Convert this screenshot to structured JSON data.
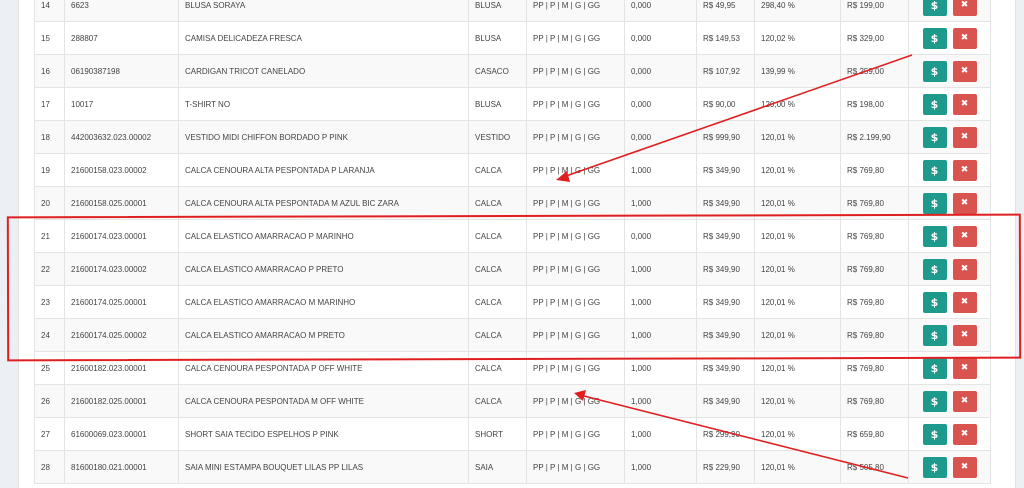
{
  "table": {
    "rows": [
      {
        "num": "14",
        "code": "6623",
        "desc": "BLUSA SORAYA",
        "cat": "BLUSA",
        "sizes": "PP | P | M | G | GG",
        "qty": "0,000",
        "cost": "R$ 49,95",
        "margin": "298,40 %",
        "price": "R$ 199,00"
      },
      {
        "num": "15",
        "code": "288807",
        "desc": "CAMISA DELICADEZA FRESCA",
        "cat": "BLUSA",
        "sizes": "PP | P | M | G | GG",
        "qty": "0,000",
        "cost": "R$ 149,53",
        "margin": "120,02 %",
        "price": "R$ 329,00"
      },
      {
        "num": "16",
        "code": "06190387198",
        "desc": "CARDIGAN TRICOT CANELADO",
        "cat": "CASACO",
        "sizes": "PP | P | M | G | GG",
        "qty": "0,000",
        "cost": "R$ 107,92",
        "margin": "139,99 %",
        "price": "R$ 259,00"
      },
      {
        "num": "17",
        "code": "10017",
        "desc": "T-SHIRT NO",
        "cat": "BLUSA",
        "sizes": "PP | P | M | G | GG",
        "qty": "0,000",
        "cost": "R$ 90,00",
        "margin": "120,00 %",
        "price": "R$ 198,00"
      },
      {
        "num": "18",
        "code": "442003632.023.00002",
        "desc": "VESTIDO MIDI CHIFFON BORDADO P PINK",
        "cat": "VESTIDO",
        "sizes": "PP | P | M | G | GG",
        "qty": "0,000",
        "cost": "R$ 999,90",
        "margin": "120,01 %",
        "price": "R$ 2.199,90"
      },
      {
        "num": "19",
        "code": "21600158.023.00002",
        "desc": "CALCA CENOURA ALTA PESPONTADA P LARANJA",
        "cat": "CALCA",
        "sizes": "PP | P | M | G | GG",
        "qty": "1,000",
        "cost": "R$ 349,90",
        "margin": "120,01 %",
        "price": "R$ 769,80"
      },
      {
        "num": "20",
        "code": "21600158.025.00001",
        "desc": "CALCA CENOURA ALTA PESPONTADA M AZUL BIC ZARA",
        "cat": "CALCA",
        "sizes": "PP | P | M | G | GG",
        "qty": "1,000",
        "cost": "R$ 349,90",
        "margin": "120,01 %",
        "price": "R$ 769,80"
      },
      {
        "num": "21",
        "code": "21600174.023.00001",
        "desc": "CALCA ELASTICO AMARRACAO P MARINHO",
        "cat": "CALCA",
        "sizes": "PP | P | M | G | GG",
        "qty": "0,000",
        "cost": "R$ 349,90",
        "margin": "120,01 %",
        "price": "R$ 769,80"
      },
      {
        "num": "22",
        "code": "21600174.023.00002",
        "desc": "CALCA ELASTICO AMARRACAO P PRETO",
        "cat": "CALCA",
        "sizes": "PP | P | M | G | GG",
        "qty": "1,000",
        "cost": "R$ 349,90",
        "margin": "120,01 %",
        "price": "R$ 769,80"
      },
      {
        "num": "23",
        "code": "21600174.025.00001",
        "desc": "CALCA ELASTICO AMARRACAO M MARINHO",
        "cat": "CALCA",
        "sizes": "PP | P | M | G | GG",
        "qty": "1,000",
        "cost": "R$ 349,90",
        "margin": "120,01 %",
        "price": "R$ 769,80"
      },
      {
        "num": "24",
        "code": "21600174.025.00002",
        "desc": "CALCA ELASTICO AMARRACAO M PRETO",
        "cat": "CALCA",
        "sizes": "PP | P | M | G | GG",
        "qty": "1,000",
        "cost": "R$ 349,90",
        "margin": "120,01 %",
        "price": "R$ 769,80"
      },
      {
        "num": "25",
        "code": "21600182.023.00001",
        "desc": "CALCA CENOURA PESPONTADA P OFF WHITE",
        "cat": "CALCA",
        "sizes": "PP | P | M | G | GG",
        "qty": "1,000",
        "cost": "R$ 349,90",
        "margin": "120,01 %",
        "price": "R$ 769,80"
      },
      {
        "num": "26",
        "code": "21600182.025.00001",
        "desc": "CALCA CENOURA PESPONTADA M OFF WHITE",
        "cat": "CALCA",
        "sizes": "PP | P | M | G | GG",
        "qty": "1,000",
        "cost": "R$ 349,90",
        "margin": "120,01 %",
        "price": "R$ 769,80"
      },
      {
        "num": "27",
        "code": "61600069.023.00001",
        "desc": "SHORT SAIA TECIDO ESPELHOS P PINK",
        "cat": "SHORT",
        "sizes": "PP | P | M | G | GG",
        "qty": "1,000",
        "cost": "R$ 299,90",
        "margin": "120,01 %",
        "price": "R$ 659,80"
      },
      {
        "num": "28",
        "code": "81600180.021.00001",
        "desc": "SAIA MINI ESTAMPA BOUQUET LILAS PP LILAS",
        "cat": "SAIA",
        "sizes": "PP | P | M | G | GG",
        "qty": "1,000",
        "cost": "R$ 229,90",
        "margin": "120,01 %",
        "price": "R$ 505,80"
      }
    ],
    "money_icon": "$",
    "delete_icon": "✖"
  },
  "colors": {
    "money_button": "#1e9a8c",
    "delete_button": "#d9534f",
    "annotation": "#e02020"
  }
}
